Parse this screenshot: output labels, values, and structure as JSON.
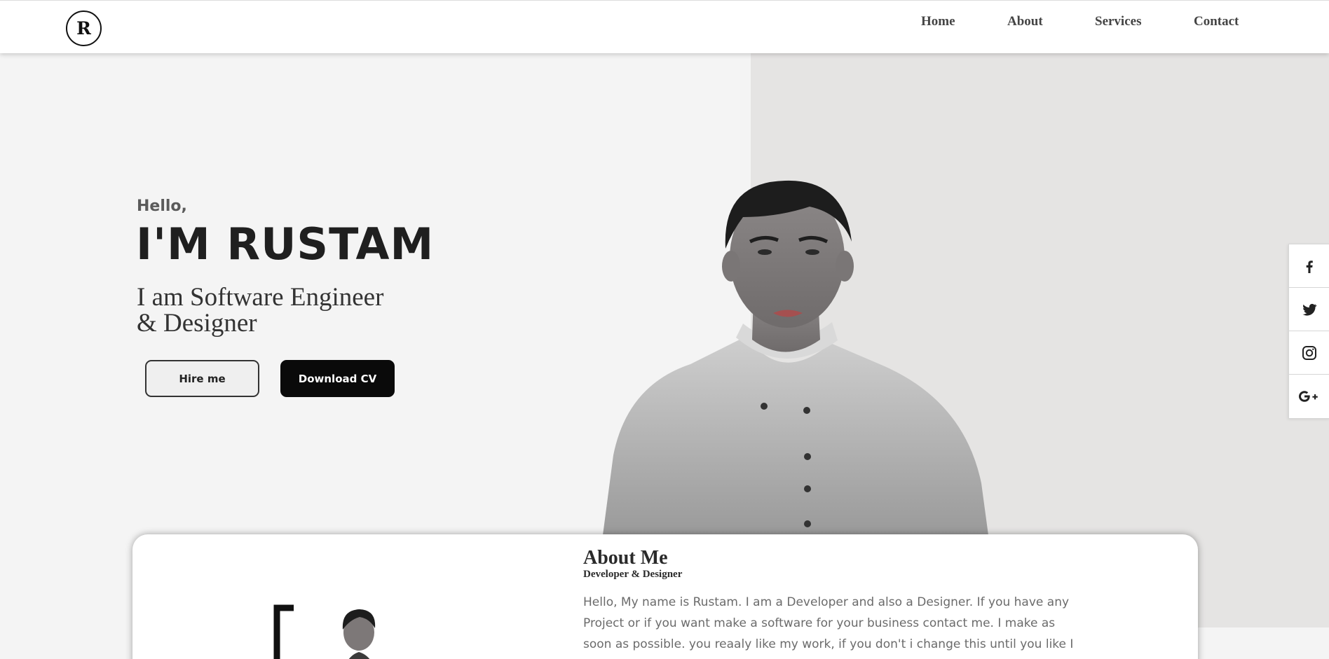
{
  "nav": {
    "logo": "R",
    "links": [
      "Home",
      "About",
      "Services",
      "Contact"
    ]
  },
  "hero": {
    "greeting": "Hello,",
    "name": "I'M RUSTAM",
    "role_line1": "I am Software Engineer",
    "role_line2": "& Designer",
    "hire_label": "Hire me",
    "cv_label": "Download CV"
  },
  "social": [
    "facebook-icon",
    "twitter-icon",
    "instagram-icon",
    "google-plus-icon"
  ],
  "about": {
    "title": "About Me",
    "subtitle": "Developer & Designer",
    "text": "Hello, My name is Rustam. I am a Developer and also a Designer. If you have any Project or if you want make a software for your business contact me. I make as soon as possible. you reaaly like my work, if you don't i change this until you like I give you"
  },
  "colors": {
    "accent": "#0a0a0a",
    "bg_left": "#f4f4f4",
    "bg_right": "#e5e4e3"
  }
}
